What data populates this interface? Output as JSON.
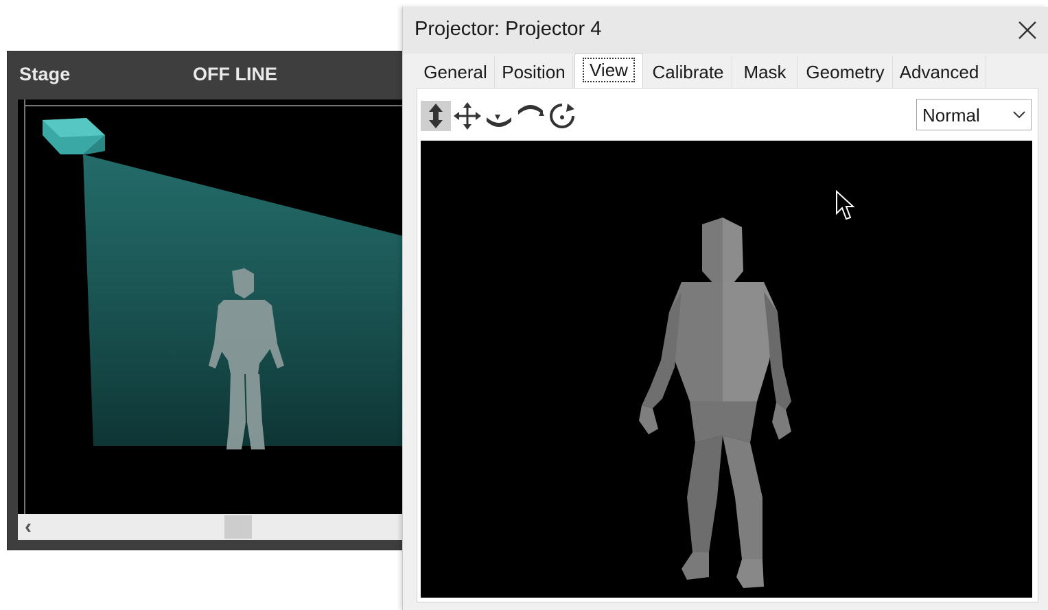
{
  "stage": {
    "title": "Stage",
    "status": "OFF LINE"
  },
  "projector": {
    "title": "Projector: Projector 4",
    "tabs": [
      {
        "label": "General"
      },
      {
        "label": "Position"
      },
      {
        "label": "View",
        "active": true
      },
      {
        "label": "Calibrate"
      },
      {
        "label": "Mask"
      },
      {
        "label": "Geometry"
      },
      {
        "label": "Advanced"
      }
    ],
    "toolbar": {
      "tools": [
        {
          "icon": "dolly-icon",
          "pressed": true
        },
        {
          "icon": "pan-icon"
        },
        {
          "icon": "orbit-horizontal-icon"
        },
        {
          "icon": "orbit-vertical-icon"
        },
        {
          "icon": "rotate-icon"
        }
      ],
      "view_mode": "Normal"
    }
  },
  "colors": {
    "stage_bg": "#3e3e3e",
    "projector_cone": "#2a8c8a",
    "projector_body": "#3fb3b0",
    "figure": "#7a7a7a"
  }
}
